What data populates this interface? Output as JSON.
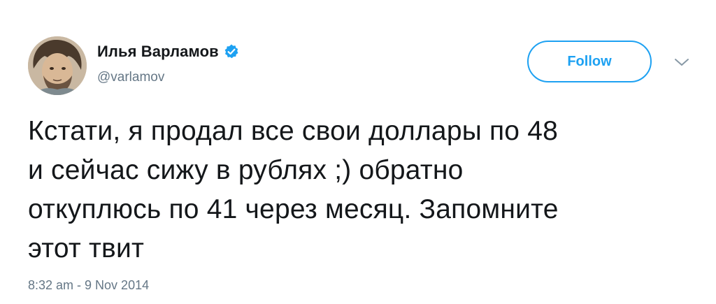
{
  "user": {
    "display_name": "Илья Варламов",
    "handle": "@varlamov",
    "verified": true,
    "verified_icon": "verified-badge-icon",
    "avatar_icon": "avatar-photo"
  },
  "actions": {
    "follow_label": "Follow",
    "menu_icon": "chevron-down-icon"
  },
  "tweet": {
    "text": "Кстати, я продал все свои доллары по 48\nи сейчас сижу в рублях ;) обратно\nоткуплюсь по 41 через месяц. Запомните\nэтот твит",
    "timestamp": "8:32 am - 9 Nov 2014"
  },
  "colors": {
    "accent": "#1da1f2",
    "text": "#14171a",
    "muted": "#657786",
    "background": "#ffffff"
  }
}
